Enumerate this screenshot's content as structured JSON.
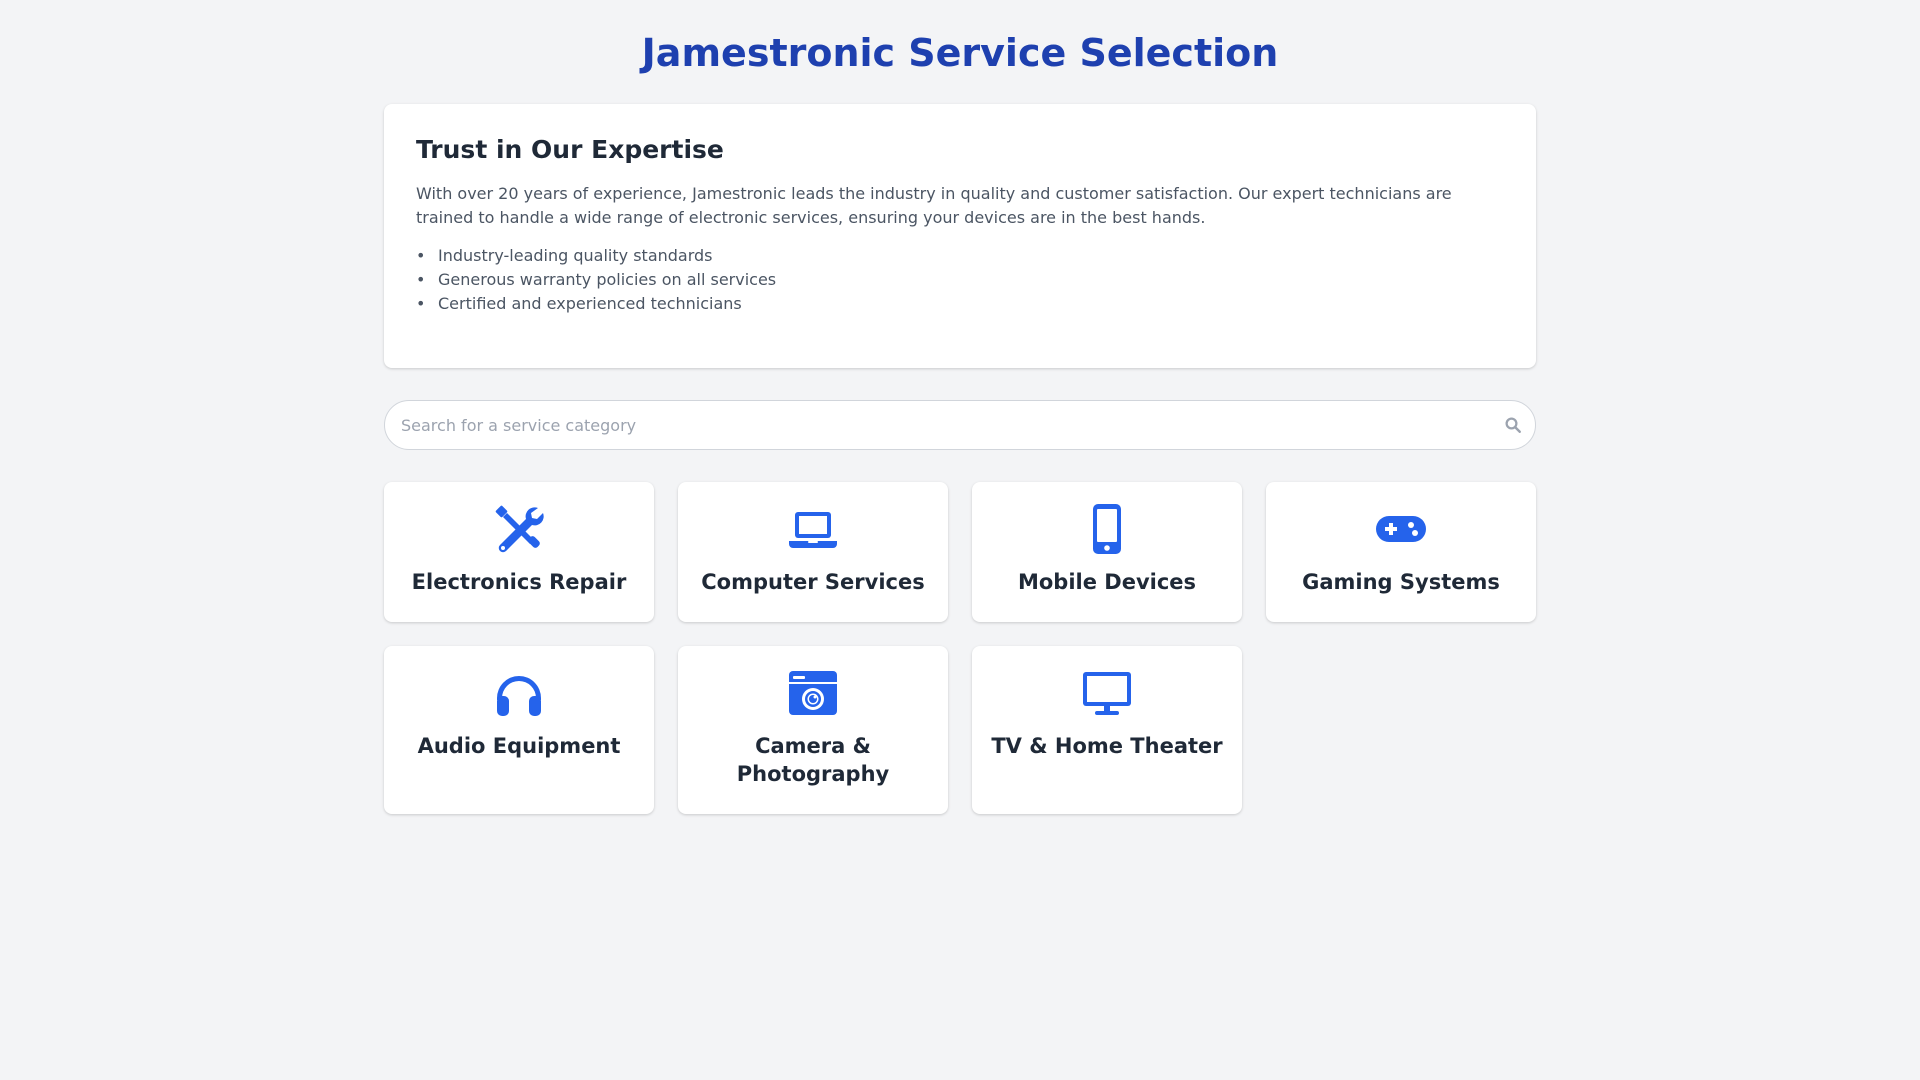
{
  "header": {
    "title": "Jamestronic Service Selection"
  },
  "trust": {
    "title": "Trust in Our Expertise",
    "description": "With over 20 years of experience, Jamestronic leads the industry in quality and customer satisfaction. Our expert technicians are trained to handle a wide range of electronic services, ensuring your devices are in the best hands.",
    "points": [
      "Industry-leading quality standards",
      "Generous warranty policies on all services",
      "Certified and experienced technicians"
    ]
  },
  "search": {
    "placeholder": "Search for a service category",
    "value": "",
    "icon": "search-icon"
  },
  "colors": {
    "accent": "#2563eb",
    "title": "#1e40af",
    "background": "#f3f4f6"
  },
  "categories": [
    {
      "label": "Electronics Repair",
      "icon": "tools-icon"
    },
    {
      "label": "Computer Services",
      "icon": "laptop-icon"
    },
    {
      "label": "Mobile Devices",
      "icon": "mobile-phone-icon"
    },
    {
      "label": "Gaming Systems",
      "icon": "gamepad-icon"
    },
    {
      "label": "Audio Equipment",
      "icon": "headphones-icon"
    },
    {
      "label": "Camera & Photography",
      "icon": "camera-icon"
    },
    {
      "label": "TV & Home Theater",
      "icon": "tv-icon"
    }
  ]
}
